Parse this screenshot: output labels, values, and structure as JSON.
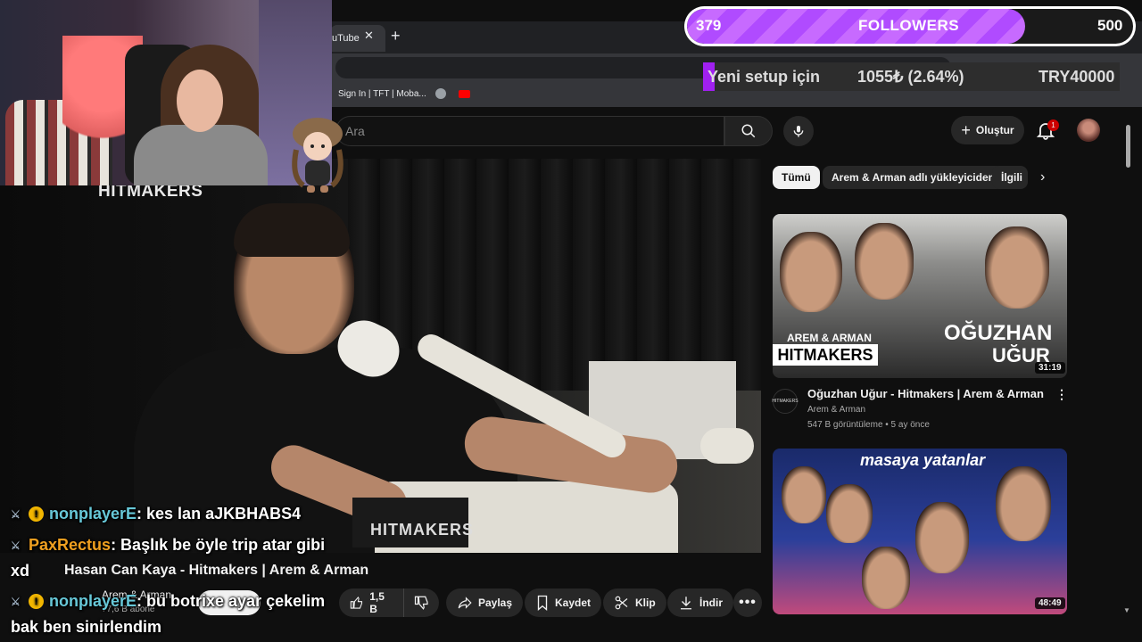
{
  "browser": {
    "tab_title": "uTube",
    "tab_close": "✕",
    "new_tab": "+",
    "bookmark_1": "Sign In | TFT | Moba...",
    "window_min": "—",
    "window_max": "⧉",
    "window_close": "✕"
  },
  "header": {
    "search_placeholder": "Ara",
    "create_label": "Oluştur",
    "notification_count": "1"
  },
  "chips": [
    "Tümü",
    "Arem & Arman adlı yükleyiciden",
    "İlgili"
  ],
  "video": {
    "overlay_logo": "HITMAKERS",
    "chair_label": "HITMAKERS",
    "title": "Hasan Can Kaya - Hitmakers | Arem & Arman",
    "channel": "Arem & Arman",
    "subscribers": "77,6 B abone",
    "like_count": "1,5 B",
    "share_label": "Paylaş",
    "save_label": "Kaydet",
    "clip_label": "Klip",
    "download_label": "İndir"
  },
  "sidebar": {
    "videos": [
      {
        "title": "Oğuzhan Uğur - Hitmakers | Arem & Arman",
        "channel": "Arem & Arman",
        "meta": "547 B görüntüleme • 5 ay önce",
        "duration": "31:19",
        "thumb_brand_top": "AREM & ARMAN",
        "thumb_brand_bottom": "HITMAKERS",
        "thumb_name_1": "OĞUZHAN",
        "thumb_name_2": "UĞUR",
        "channel_avatar_text": "HITMAKERS"
      },
      {
        "duration": "48:49",
        "thumb_title": "masaya yatanlar"
      }
    ]
  },
  "followers_goal": {
    "current": "379",
    "label": "FOLLOWERS",
    "goal": "500",
    "progress": 0.758,
    "fill_color": "#b04bff"
  },
  "donation_goal": {
    "label": "Yeni setup için",
    "amount": "1055₺ (2.64%)",
    "target": "TRY40000",
    "progress": 0.0264,
    "fill_color": "#a020f0"
  },
  "chat": [
    {
      "user": "nonplayerE",
      "text": " : kes lan aJKBHABS4",
      "color": "#67c8d8"
    },
    {
      "user": "PaxRectus",
      "text": " : Başlık be öyle trip atar gibi",
      "color": "#f0a020"
    },
    {
      "user": "",
      "text": "xd",
      "color": "#ffffff"
    },
    {
      "user": "nonplayerE",
      "text": " : bu botrixe ayar çekelim",
      "color": "#67c8d8"
    },
    {
      "user": "",
      "text": "bak ben sinirlendim",
      "color": "#ffffff"
    }
  ],
  "icons": {
    "mod": "mod-badge-icon",
    "gold": "gold-badge-icon",
    "gold_glyph": "!"
  }
}
